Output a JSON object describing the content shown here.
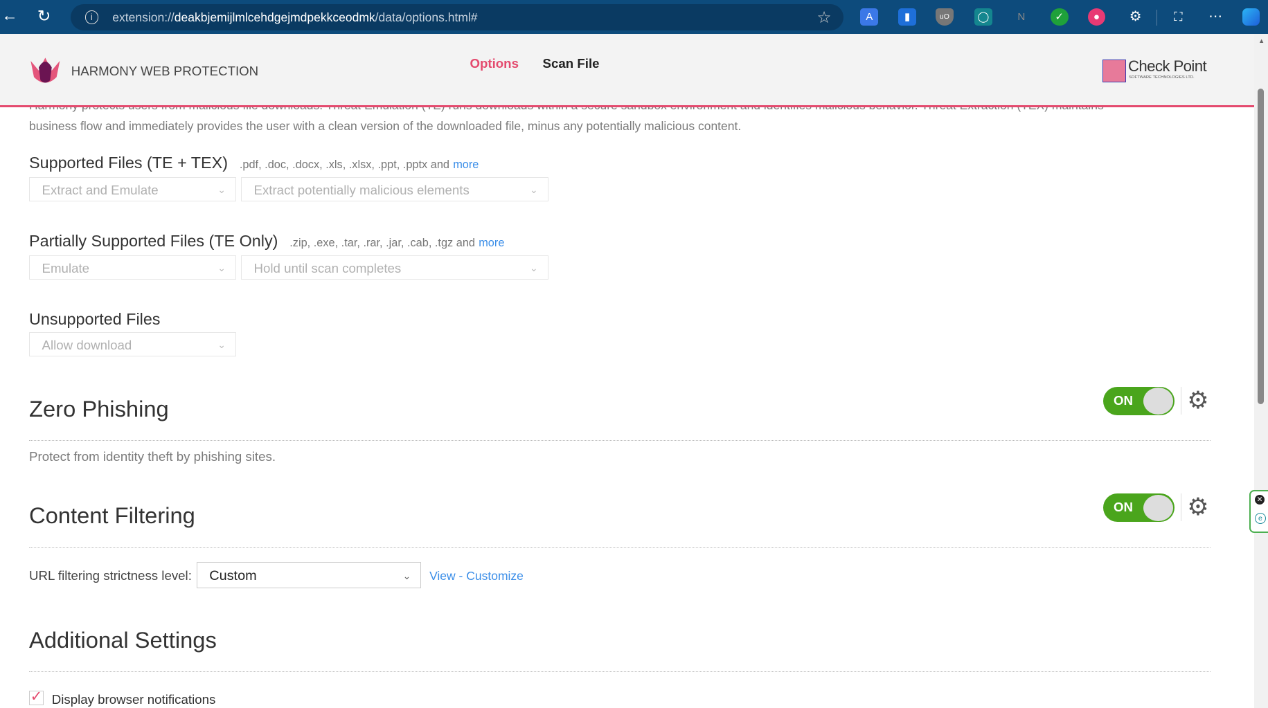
{
  "browser": {
    "url_prefix": "extension://",
    "url_host": "deakbjemijlmlcehdgejmdpekkceodmk",
    "url_path": "/data/options.html#"
  },
  "header": {
    "title": "HARMONY WEB PROTECTION",
    "nav": [
      {
        "label": "Options",
        "active": true
      },
      {
        "label": "Scan File",
        "active": false
      }
    ],
    "brand": "Check Point",
    "brand_sub": "SOFTWARE TECHNOLOGIES LTD."
  },
  "intro": {
    "line1": "Harmony protects users from malicious file downloads. Threat Emulation (TE) runs downloads within a secure sandbox environment and identifies malicious behavior. Threat Extraction (TEX) maintains",
    "line2": "business flow and immediately provides the user with a clean version of the downloaded file, minus any potentially malicious content."
  },
  "supported": {
    "title": "Supported Files (TE + TEX)",
    "exts": ".pdf, .doc, .docx, .xls, .xlsx, .ppt, .pptx and",
    "more": "more",
    "select1": "Extract and Emulate",
    "select2": "Extract potentially malicious elements"
  },
  "partial": {
    "title": "Partially Supported Files (TE Only)",
    "exts": ".zip, .exe, .tar, .rar, .jar, .cab, .tgz and",
    "more": "more",
    "select1": "Emulate",
    "select2": "Hold until scan completes"
  },
  "unsupported": {
    "title": "Unsupported Files",
    "select1": "Allow download"
  },
  "zero_phishing": {
    "title": "Zero Phishing",
    "toggle": "ON",
    "description": "Protect from identity theft by phishing sites."
  },
  "content_filtering": {
    "title": "Content Filtering",
    "toggle": "ON",
    "url_label": "URL filtering strictness level:",
    "url_value": "Custom",
    "view": "View",
    "sep": " - ",
    "customize": "Customize"
  },
  "additional": {
    "title": "Additional Settings",
    "notifications": "Display browser notifications",
    "notifications_checked": true
  },
  "colors": {
    "accent": "#e44a6e",
    "toggle_on": "#4aa51c",
    "link": "#3b8ee8"
  }
}
